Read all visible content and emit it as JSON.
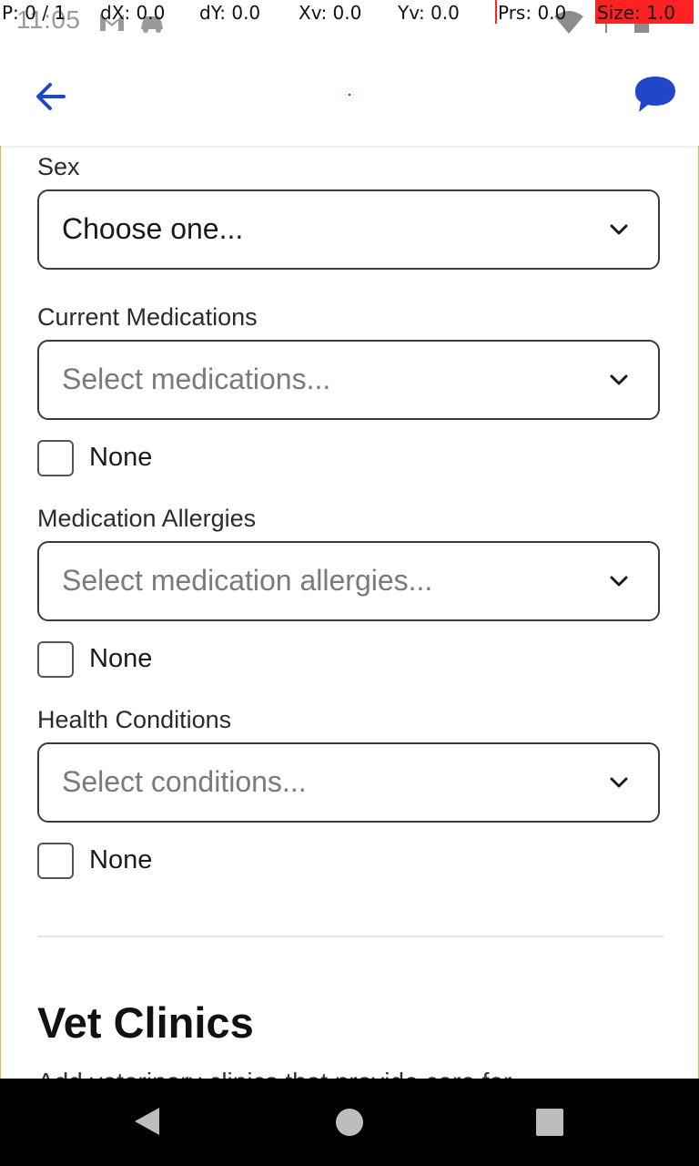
{
  "status_bar": {
    "time": "11:05",
    "pointer_overlay": {
      "p": "P: 0 / 1",
      "dx": "dX: 0.0",
      "dy": "dY: 0.0",
      "xv": "Xv: 0.0",
      "yv": "Yv: 0.0",
      "prs": "Prs: 0.0",
      "size": "Size: 1.0"
    }
  },
  "colors": {
    "accent": "#1f47c7",
    "card_border": "#e0b84a"
  },
  "form": {
    "sex": {
      "label": "Sex",
      "value": "Choose one..."
    },
    "medications": {
      "label": "Current Medications",
      "placeholder": "Select medications...",
      "none_label": "None"
    },
    "allergies": {
      "label": "Medication Allergies",
      "placeholder": "Select medication allergies...",
      "none_label": "None"
    },
    "conditions": {
      "label": "Health Conditions",
      "placeholder": "Select conditions...",
      "none_label": "None"
    }
  },
  "vet_clinics": {
    "title": "Vet Clinics",
    "description": "Add veterinary clinics that provide care for..."
  }
}
